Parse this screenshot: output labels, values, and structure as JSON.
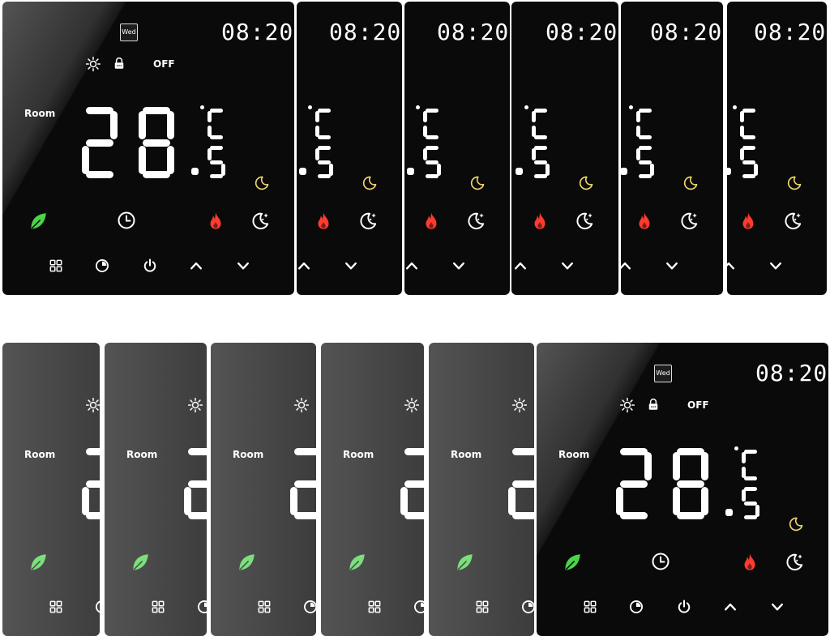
{
  "display": {
    "day": "Wed",
    "time": "08:20",
    "power_state": "OFF",
    "sensor_label": "Room",
    "temperature": "28.5",
    "unit": "°C"
  },
  "colors": {
    "panel": "#0a0a0b",
    "segment": "#ffffff",
    "leaf": "#4cd34c",
    "flame": "#ff3b2f",
    "moon": "#f2d56b"
  },
  "icons": {
    "status_row": [
      "sun-icon",
      "lock-icon"
    ],
    "mode_row": [
      "leaf-icon",
      "clock-icon",
      "flame-icon",
      "moon-stars-icon",
      "moon-icon"
    ],
    "button_row": [
      "grid-icon",
      "timer-icon",
      "power-icon",
      "chevron-up-icon",
      "chevron-down-icon"
    ]
  },
  "variants": {
    "top_row_count": 6,
    "bottom_row_count": 6
  }
}
